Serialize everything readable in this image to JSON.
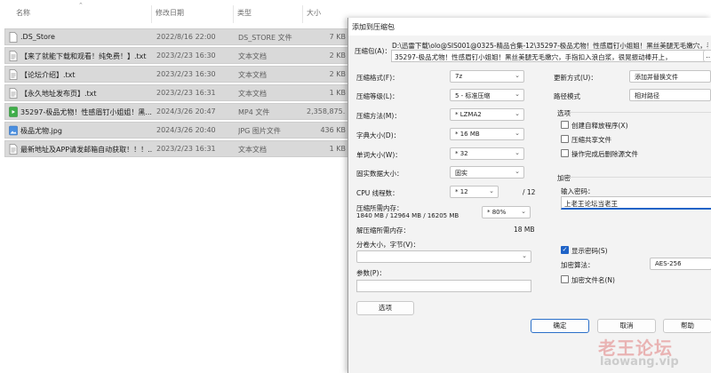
{
  "explorer": {
    "columns": {
      "name": "名称",
      "date": "修改日期",
      "type": "类型",
      "size": "大小"
    },
    "sort_icon": "chevron-up-icon",
    "files": [
      {
        "name": ".DS_Store",
        "date": "2022/8/16 22:00",
        "type": "DS_STORE 文件",
        "size": "7 KB",
        "icon": "file-icon"
      },
      {
        "name": "【来了就能下载和观看！纯免费！】.txt",
        "date": "2023/2/23 16:30",
        "type": "文本文档",
        "size": "2 KB",
        "icon": "text-file-icon"
      },
      {
        "name": "【论坛介绍】.txt",
        "date": "2023/2/23 16:30",
        "type": "文本文档",
        "size": "2 KB",
        "icon": "text-file-icon"
      },
      {
        "name": "【永久地址发布页】.txt",
        "date": "2023/2/23 16:31",
        "type": "文本文档",
        "size": "1 KB",
        "icon": "text-file-icon"
      },
      {
        "name": "35297-极品尤物！性感眉钉小姐姐！黑...",
        "date": "2024/3/26 20:47",
        "type": "MP4 文件",
        "size": "2,358,875...",
        "icon": "video-file-icon"
      },
      {
        "name": "极品尤物.jpg",
        "date": "2024/3/26 20:40",
        "type": "JPG 图片文件",
        "size": "436 KB",
        "icon": "image-file-icon"
      },
      {
        "name": "最新地址及APP请发邮箱自动获取！！！...",
        "date": "2023/2/23 16:31",
        "type": "文本文档",
        "size": "1 KB",
        "icon": "text-file-icon"
      }
    ]
  },
  "dialog": {
    "title": "添加到压缩包",
    "archive_label": "压缩包(A)：",
    "archive_path_line1": "D:\\迅雷下载\\olo@SIS001@0325-精品合集-12\\35297-极品尤物！性感眉钉小姐姐！黑丝美腿无毛嫩穴，手指扣",
    "archive_path_line2": "35297-极品尤物！性感眉钉小姐姐！黑丝美腿无毛嫩穴，手指扣入浪白浆，很晃振动棒开上，",
    "format_label": "压缩格式(F)：",
    "format_value": "7z",
    "level_label": "压缩等级(L)：",
    "level_value": "5 - 标准压缩",
    "method_label": "压缩方法(M)：",
    "method_value": "* LZMA2",
    "dict_label": "字典大小(D)：",
    "dict_value": "* 16 MB",
    "word_label": "单词大小(W)：",
    "word_value": "* 32",
    "solid_label": "固实数据大小：",
    "solid_value": "固实",
    "threads_label": "CPU 线程数：",
    "threads_value": "* 12",
    "threads_total": "/ 12",
    "mem_label": "压缩所需内存：",
    "mem_detail": "1840 MB / 12964 MB / 16205 MB",
    "mem_percent": "* 80%",
    "decomp_label": "解压缩所需内存：",
    "decomp_value": "18 MB",
    "split_label": "分卷大小，字节(V)：",
    "split_value": "",
    "params_label": "参数(P)：",
    "params_value": "",
    "options_button": "选项",
    "update_label": "更新方式(U)：",
    "update_value": "添加并替换文件",
    "path_label": "路径模式",
    "path_value": "相对路径",
    "options_group": "选项",
    "opt_sfx": "创建自释放程序(X)",
    "opt_shared": "压缩共享文件",
    "opt_delete": "操作完成后删除源文件",
    "encrypt_group": "加密",
    "password_label": "输入密码：",
    "password_value": "上老王论坛当老王",
    "show_password": "显示密码(S)",
    "enc_method_label": "加密算法：",
    "enc_method_value": "AES-256",
    "enc_names": "加密文件名(N)",
    "ok_button": "确定",
    "cancel_button": "取消",
    "help_button": "帮助",
    "browse_button": "..."
  },
  "watermark": {
    "cn": "老王论坛",
    "url": "laowang.vip"
  },
  "colors": {
    "accent": "#1f63c7",
    "row_selected": "#d9d9d9",
    "dialog_bg": "#f3f3f3"
  }
}
